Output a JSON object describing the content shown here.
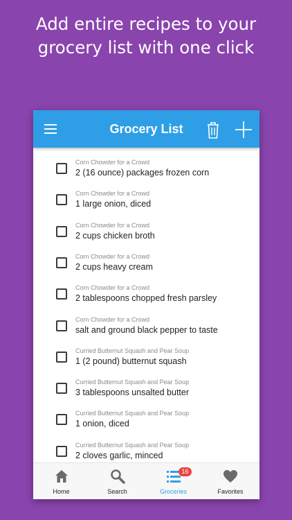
{
  "headline": {
    "line1": "Add entire recipes to your",
    "line2": "grocery list with one click"
  },
  "colors": {
    "background": "#8a44ad",
    "appbar": "#2e9fe6",
    "active": "#2e9fe6",
    "inactive_icon": "#6b6b6b",
    "badge": "#e8453c"
  },
  "appbar": {
    "title": "Grocery List",
    "icons": [
      "menu-icon",
      "trash-icon",
      "plus-icon"
    ]
  },
  "items": [
    {
      "recipe": "Corn Chowder for a Crowd",
      "ingredient": "2 (16 ounce) packages frozen corn",
      "checked": false
    },
    {
      "recipe": "Corn Chowder for a Crowd",
      "ingredient": "1 large onion, diced",
      "checked": false
    },
    {
      "recipe": "Corn Chowder for a Crowd",
      "ingredient": "2 cups chicken broth",
      "checked": false
    },
    {
      "recipe": "Corn Chowder for a Crowd",
      "ingredient": "2 cups heavy cream",
      "checked": false
    },
    {
      "recipe": "Corn Chowder for a Crowd",
      "ingredient": "2 tablespoons chopped fresh parsley",
      "checked": false
    },
    {
      "recipe": "Corn Chowder for a Crowd",
      "ingredient": "salt and ground black pepper to taste",
      "checked": false
    },
    {
      "recipe": "Curried Butternut Squash and Pear Soup",
      "ingredient": "1 (2 pound) butternut squash",
      "checked": false
    },
    {
      "recipe": "Curried Butternut Squash and Pear Soup",
      "ingredient": "3 tablespoons unsalted butter",
      "checked": false
    },
    {
      "recipe": "Curried Butternut Squash and Pear Soup",
      "ingredient": "1 onion, diced",
      "checked": false
    },
    {
      "recipe": "Curried Butternut Squash and Pear Soup",
      "ingredient": "2 cloves garlic, minced",
      "checked": false
    }
  ],
  "nav": [
    {
      "label": "Home",
      "icon": "home-icon",
      "active": false
    },
    {
      "label": "Search",
      "icon": "search-icon",
      "active": false
    },
    {
      "label": "Groceries",
      "icon": "list-icon",
      "active": true,
      "badge": "16"
    },
    {
      "label": "Favorites",
      "icon": "heart-icon",
      "active": false
    }
  ]
}
